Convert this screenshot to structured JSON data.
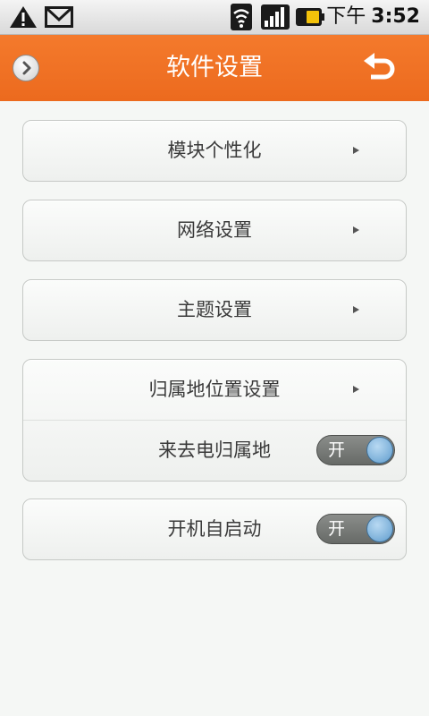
{
  "status_bar": {
    "ampm": "下午",
    "time": "3:52",
    "icons": [
      "warning-icon",
      "gmail-icon",
      "wifi-icon",
      "signal-icon",
      "battery-icon"
    ]
  },
  "header": {
    "title": "软件设置",
    "accent_color": "#f0712a",
    "icons": [
      "forward-circle-icon",
      "back-arrow-icon"
    ]
  },
  "settings": {
    "module_personalization": "模块个性化",
    "network": "网络设置",
    "theme": "主题设置",
    "location_display": "归属地位置设置",
    "incoming_call_location": {
      "label": "来去电归属地",
      "toggle": "开"
    },
    "auto_start": {
      "label": "开机自启动",
      "toggle": "开"
    }
  }
}
